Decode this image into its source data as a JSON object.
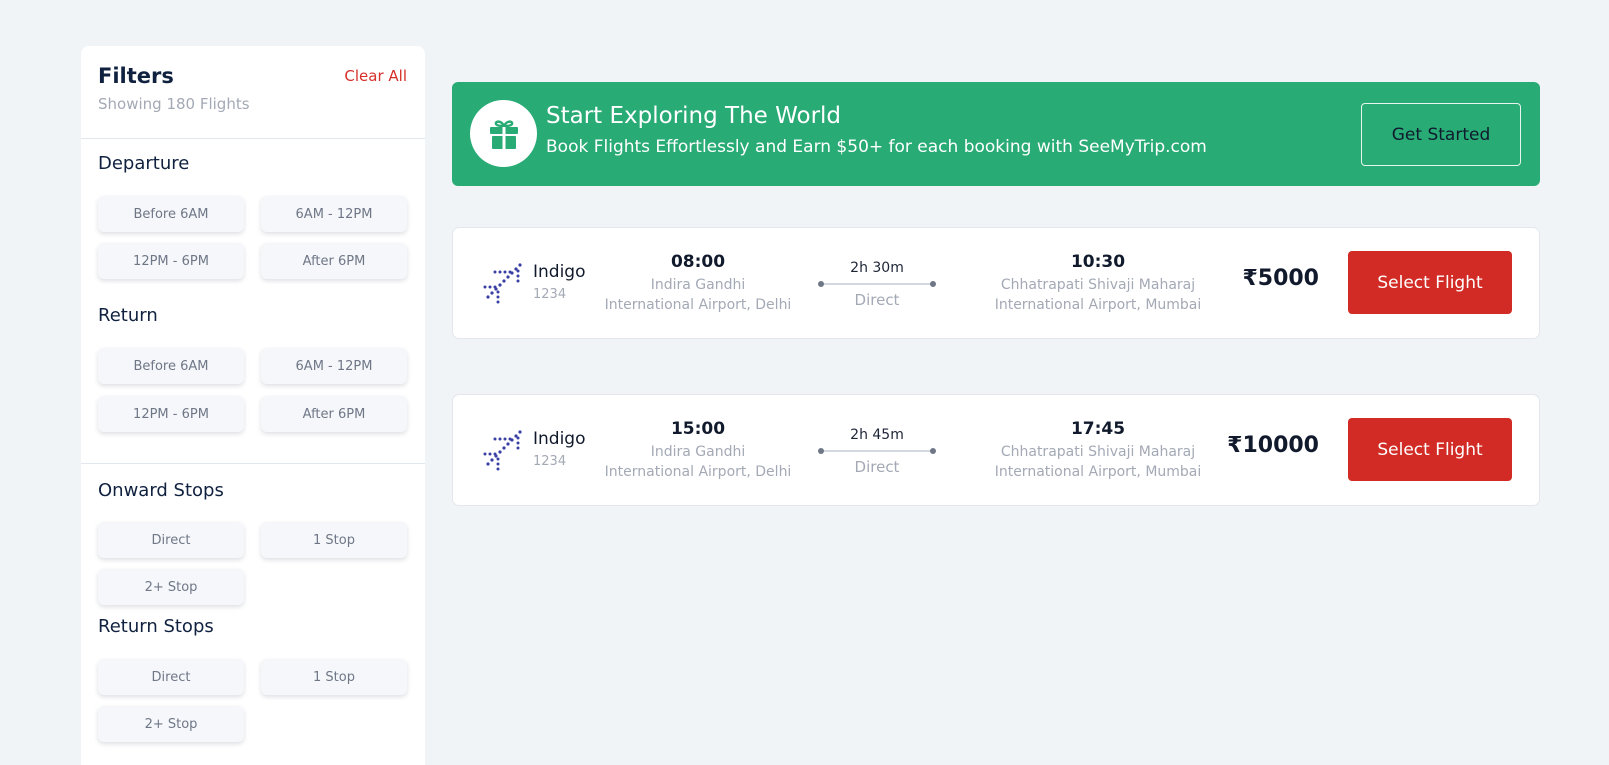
{
  "filters": {
    "title": "Filters",
    "subtitle": "Showing 180 Flights",
    "clear_label": "Clear All",
    "departure": {
      "title": "Departure",
      "options": [
        "Before 6AM",
        "6AM - 12PM",
        "12PM - 6PM",
        "After 6PM"
      ]
    },
    "return": {
      "title": "Return",
      "options": [
        "Before 6AM",
        "6AM - 12PM",
        "12PM - 6PM",
        "After 6PM"
      ]
    },
    "onward_stops": {
      "title": "Onward Stops",
      "options": [
        "Direct",
        "1 Stop",
        "2+ Stop"
      ]
    },
    "return_stops": {
      "title": "Return Stops",
      "options": [
        "Direct",
        "1 Stop",
        "2+ Stop"
      ]
    }
  },
  "banner": {
    "title": "Start Exploring The World",
    "text": "Book Flights Effortlessly and Earn $50+ for each booking with SeeMyTrip.com",
    "button_label": "Get Started",
    "icon": "gift-icon"
  },
  "flights": [
    {
      "airline": "Indigo",
      "flight_no": "1234",
      "dep_time": "08:00",
      "dep_airport_line1": "Indira Gandhi",
      "dep_airport_line2": "International Airport, Delhi",
      "duration": "2h 30m",
      "stops": "Direct",
      "arr_time": "10:30",
      "arr_airport_line1": "Chhatrapati Shivaji Maharaj",
      "arr_airport_line2": "International Airport, Mumbai",
      "price": "₹5000",
      "button_label": "Select Flight"
    },
    {
      "airline": "Indigo",
      "flight_no": "1234",
      "dep_time": "15:00",
      "dep_airport_line1": "Indira Gandhi",
      "dep_airport_line2": "International Airport, Delhi",
      "duration": "2h 45m",
      "stops": "Direct",
      "arr_time": "17:45",
      "arr_airport_line1": "Chhatrapati Shivaji Maharaj",
      "arr_airport_line2": "International Airport, Mumbai",
      "price": "₹10000",
      "button_label": "Select Flight"
    }
  ],
  "colors": {
    "background": "#f1f4f7",
    "banner": "#28ab75",
    "select_button": "#d22b25",
    "clear_all": "#d6302a",
    "airline_logo": "#3a3fa3"
  }
}
